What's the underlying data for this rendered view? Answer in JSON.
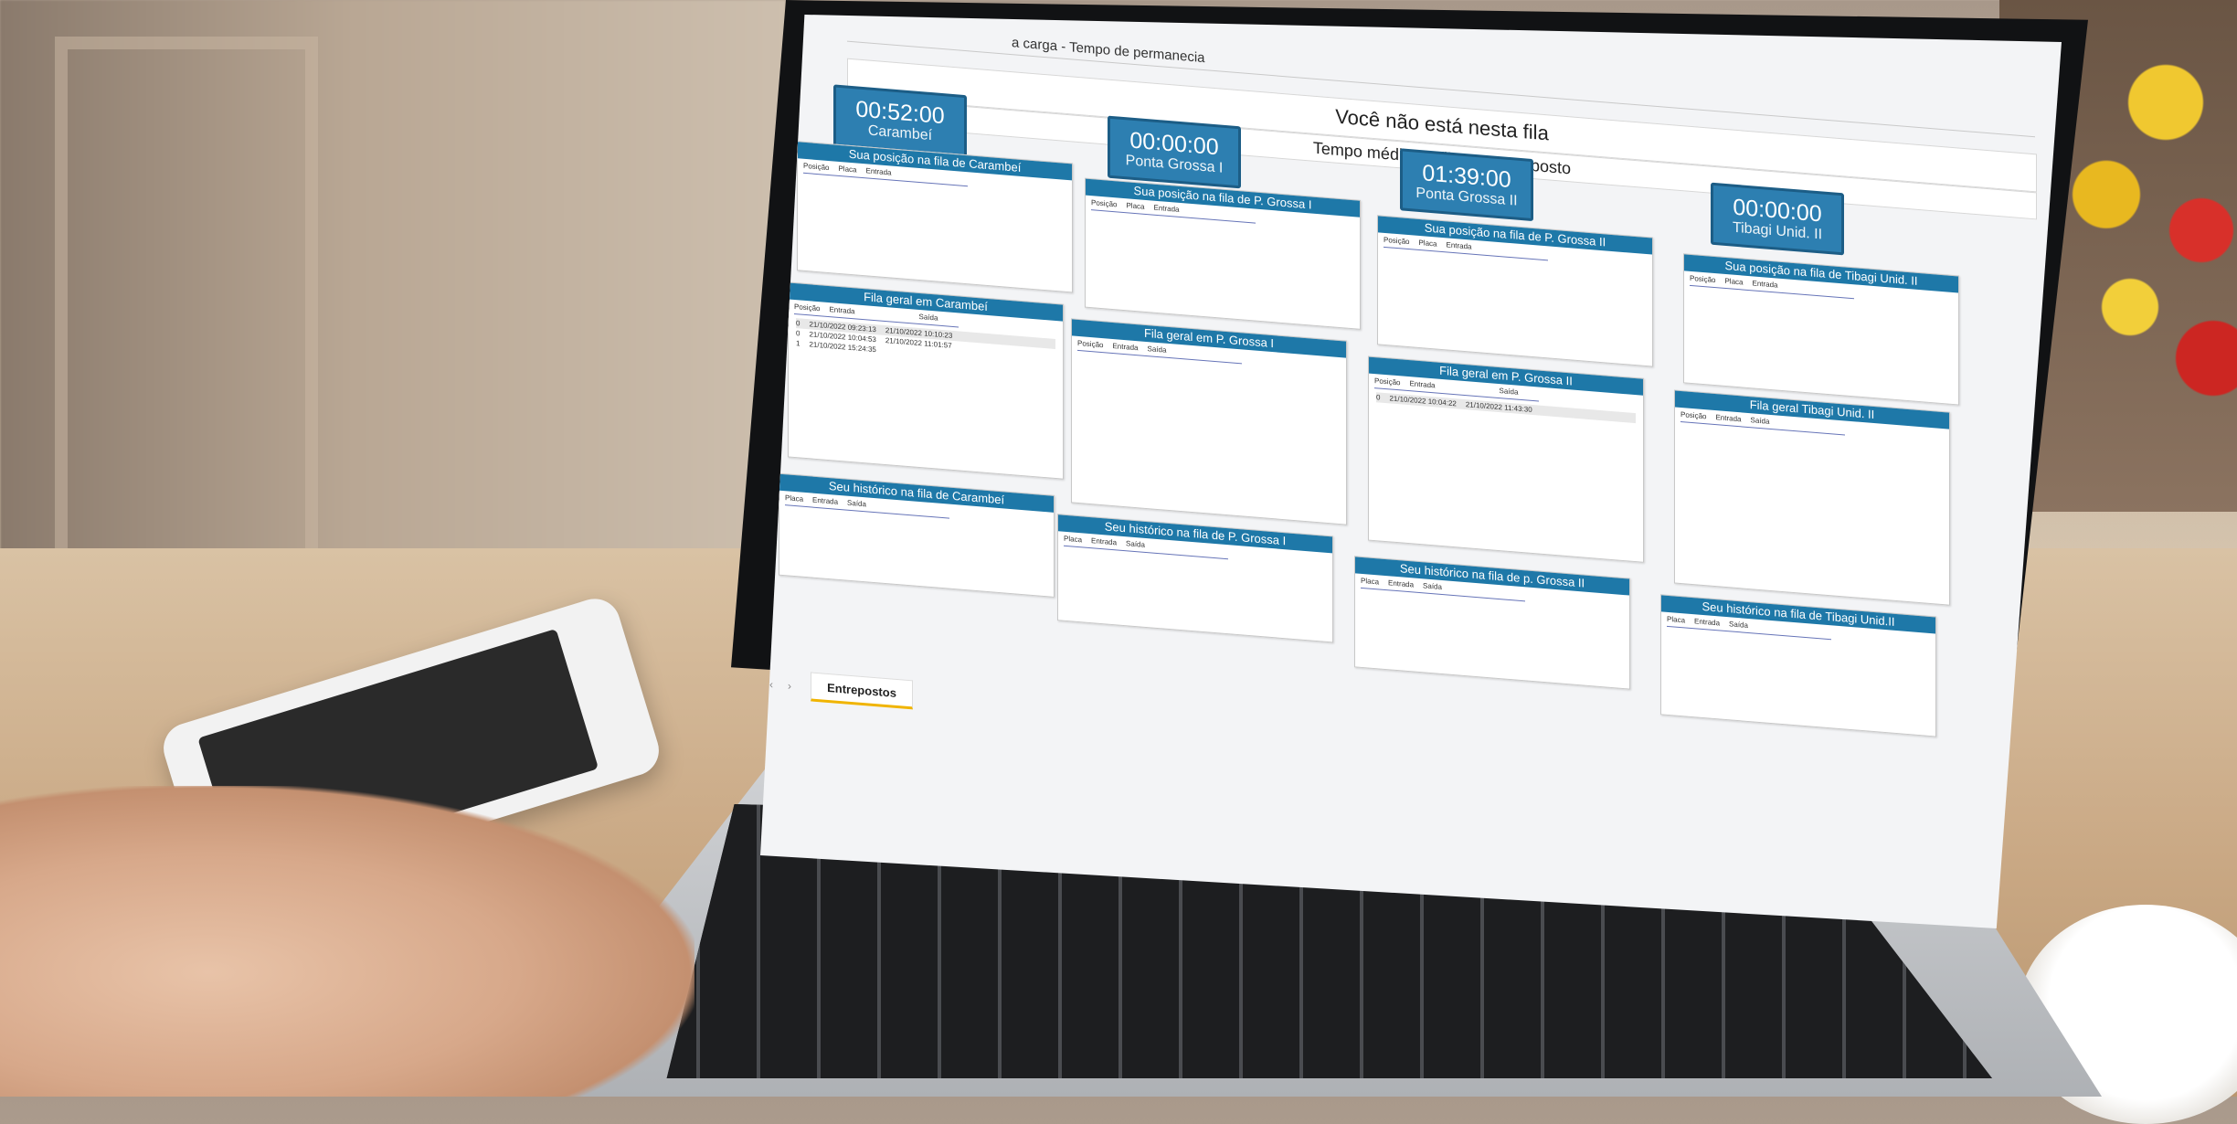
{
  "report": {
    "title_fragment": "a carga - Tempo de permanecia",
    "notice": "Você não está nesta fila",
    "avg_label": "Tempo médio na fila por entreposto"
  },
  "cards": [
    {
      "time": "00:52:00",
      "name": "Carambeí"
    },
    {
      "time": "00:00:00",
      "name": "Ponta Grossa I"
    },
    {
      "time": "01:39:00",
      "name": "Ponta Grossa II"
    },
    {
      "time": "00:00:00",
      "name": "Tibagi Unid. II"
    }
  ],
  "position_panels": [
    {
      "title": "Sua posição na fila de Carambeí",
      "cols": [
        "Posição",
        "Placa",
        "Entrada"
      ]
    },
    {
      "title": "Sua posição na fila de P. Grossa I",
      "cols": [
        "Posição",
        "Placa",
        "Entrada"
      ]
    },
    {
      "title": "Sua posição na fila de P. Grossa II",
      "cols": [
        "Posição",
        "Placa",
        "Entrada"
      ]
    },
    {
      "title": "Sua posição na fila de Tibagi Unid. II",
      "cols": [
        "Posição",
        "Placa",
        "Entrada"
      ]
    }
  ],
  "general_panels": [
    {
      "title": "Fila geral em Carambeí",
      "cols": [
        "Posição",
        "Entrada",
        "Saída"
      ],
      "rows": [
        [
          "0",
          "21/10/2022 09:23:13",
          "21/10/2022 10:10:23"
        ],
        [
          "0",
          "21/10/2022 10:04:53",
          "21/10/2022 11:01:57"
        ],
        [
          "1",
          "21/10/2022 15:24:35",
          ""
        ]
      ]
    },
    {
      "title": "Fila geral em P. Grossa I",
      "cols": [
        "Posição",
        "Entrada",
        "Saída"
      ],
      "rows": []
    },
    {
      "title": "Fila geral em P. Grossa II",
      "cols": [
        "Posição",
        "Entrada",
        "Saída"
      ],
      "rows": [
        [
          "0",
          "21/10/2022 10:04:22",
          "21/10/2022 11:43:30"
        ]
      ]
    },
    {
      "title": "Fila geral Tibagi Unid. II",
      "cols": [
        "Posição",
        "Entrada",
        "Saída"
      ],
      "rows": []
    }
  ],
  "history_panels": [
    {
      "title": "Seu histórico na fila de Carambeí",
      "cols": [
        "Placa",
        "Entrada",
        "Saída"
      ]
    },
    {
      "title": "Seu histórico na fila de P. Grossa I",
      "cols": [
        "Placa",
        "Entrada",
        "Saída"
      ]
    },
    {
      "title": "Seu histórico na fila de p. Grossa II",
      "cols": [
        "Placa",
        "Entrada",
        "Saída"
      ]
    },
    {
      "title": "Seu histórico na fila de Tibagi Unid.II",
      "cols": [
        "Placa",
        "Entrada",
        "Saída"
      ]
    }
  ],
  "tabs": {
    "prev": "‹",
    "next": "›",
    "active": "Entrepostos"
  },
  "colors": {
    "accent": "#1e78a8",
    "card": "#2d7fb1",
    "tab_underline": "#f0b400"
  }
}
